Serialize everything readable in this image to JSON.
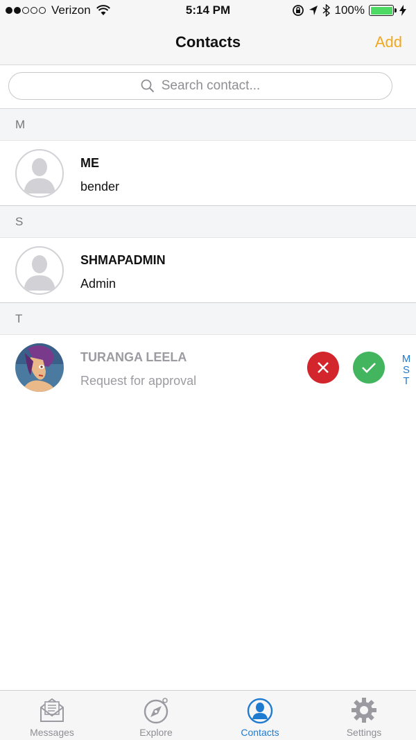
{
  "status_bar": {
    "carrier": "Verizon",
    "time": "5:14 PM",
    "battery": "100%",
    "signal_strength": 2
  },
  "nav": {
    "title": "Contacts",
    "add_label": "Add"
  },
  "search": {
    "placeholder": "Search contact..."
  },
  "sections": [
    {
      "letter": "M",
      "contact": {
        "name": "ME",
        "subtitle": "bender"
      }
    },
    {
      "letter": "S",
      "contact": {
        "name": "SHMAPADMIN",
        "subtitle": "Admin"
      }
    },
    {
      "letter": "T",
      "contact": {
        "name": "TURANGA LEELA",
        "subtitle": "Request for approval"
      }
    }
  ],
  "index": [
    "M",
    "S",
    "T"
  ],
  "tabs": [
    {
      "label": "Messages",
      "icon": "envelope-icon"
    },
    {
      "label": "Explore",
      "icon": "compass-icon"
    },
    {
      "label": "Contacts",
      "icon": "person-icon",
      "active": true
    },
    {
      "label": "Settings",
      "icon": "gear-icon"
    }
  ],
  "colors": {
    "accent_orange": "#f2a81d",
    "accent_blue": "#1f7bd0",
    "reject_red": "#d2262c",
    "accept_green": "#43b55e",
    "battery_green": "#4cd964"
  }
}
